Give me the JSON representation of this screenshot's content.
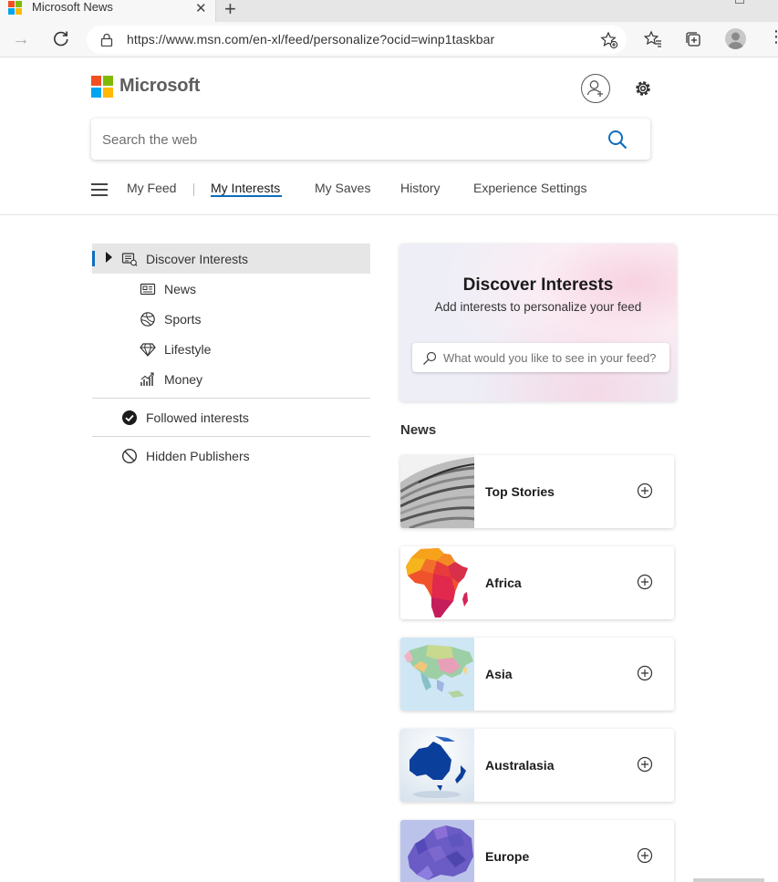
{
  "browser": {
    "tab_title": "Microsoft News",
    "tab_close": "✕",
    "new_tab": "+",
    "url": "https://www.msn.com/en-xl/feed/personalize?ocid=winp1taskbar"
  },
  "header": {
    "brand": "Microsoft",
    "search_placeholder": "Search the web"
  },
  "nav": {
    "items": [
      {
        "label": "My Feed"
      },
      {
        "label": "My Interests",
        "active": true
      },
      {
        "label": "My Saves"
      },
      {
        "label": "History"
      },
      {
        "label": "Experience Settings"
      }
    ]
  },
  "sidebar": {
    "discover": "Discover Interests",
    "sub_items": [
      {
        "label": "News",
        "icon": "newspaper-icon"
      },
      {
        "label": "Sports",
        "icon": "ball-icon"
      },
      {
        "label": "Lifestyle",
        "icon": "diamond-icon"
      },
      {
        "label": "Money",
        "icon": "chart-icon"
      }
    ],
    "followed": "Followed interests",
    "hidden": "Hidden Publishers"
  },
  "discover_card": {
    "title": "Discover Interests",
    "subtitle": "Add interests to personalize your feed",
    "search_placeholder": "What would you like to see in your feed?"
  },
  "section": {
    "title": "News",
    "topics": [
      {
        "name": "Top Stories"
      },
      {
        "name": "Africa"
      },
      {
        "name": "Asia"
      },
      {
        "name": "Australasia"
      },
      {
        "name": "Europe"
      }
    ]
  },
  "colors": {
    "accent": "#0f6cbd",
    "logo_red": "#f25022",
    "logo_green": "#7fba00",
    "logo_blue": "#00a4ef",
    "logo_yellow": "#ffb900"
  }
}
